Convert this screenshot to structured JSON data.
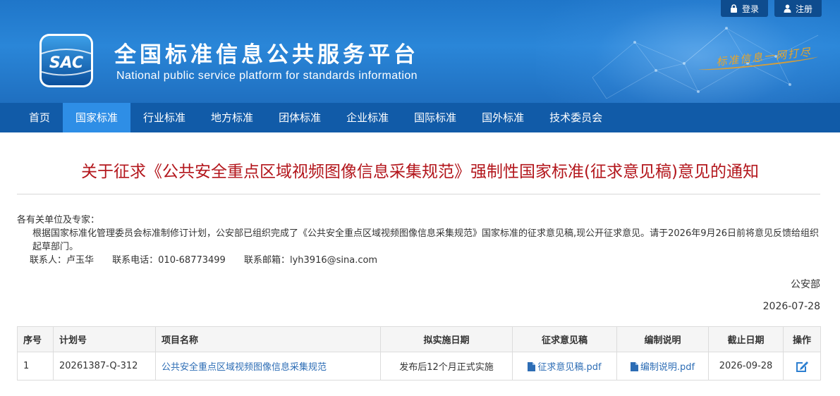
{
  "header": {
    "login_label": "登录",
    "register_label": "注册",
    "logo_text": "SAC",
    "title": "全国标准信息公共服务平台",
    "subtitle": "National public service platform  for standards information",
    "slogan": "标准信息一网打尽"
  },
  "nav": {
    "items": [
      "首页",
      "国家标准",
      "行业标准",
      "地方标准",
      "团体标准",
      "企业标准",
      "国际标准",
      "国外标准",
      "技术委员会"
    ],
    "active": "国家标准"
  },
  "notice": {
    "title": "关于征求《公共安全重点区域视频图像信息采集规范》强制性国家标准(征求意见稿)意见的通知",
    "greeting": "各有关单位及专家：",
    "paragraph": "根据国家标准化管理委员会标准制修订计划，公安部已组织完成了《公共安全重点区域视频图像信息采集规范》国家标准的征求意见稿,现公开征求意见。请于2026年9月26日前将意见反馈给组织起草部门。",
    "contact_person": "联系人：卢玉华",
    "contact_phone": "联系电话：010-68773499",
    "contact_email": "联系邮箱：lyh3916@sina.com",
    "signature": "公安部",
    "date": "2026-07-28"
  },
  "table": {
    "headers": [
      "序号",
      "计划号",
      "项目名称",
      "拟实施日期",
      "征求意见稿",
      "编制说明",
      "截止日期",
      "操作"
    ],
    "rows": [
      {
        "index": "1",
        "plan_no": "20261387-Q-312",
        "project_name": "公共安全重点区域视频图像信息采集规范",
        "implement_date": "发布后12个月正式实施",
        "draft_file": "征求意见稿.pdf",
        "explanation_file": "编制说明.pdf",
        "deadline": "2026-09-28"
      }
    ]
  },
  "colors": {
    "banner_blue": "#2a86d8",
    "nav_blue": "#115ba8",
    "nav_active": "#2e8ee6",
    "title_red": "#b3161c",
    "link_blue": "#2d6db5",
    "slogan_gold": "#e8a52a"
  },
  "icons": {
    "login": "lock-icon",
    "register": "user-icon",
    "file": "file-icon",
    "action": "edit-icon"
  }
}
